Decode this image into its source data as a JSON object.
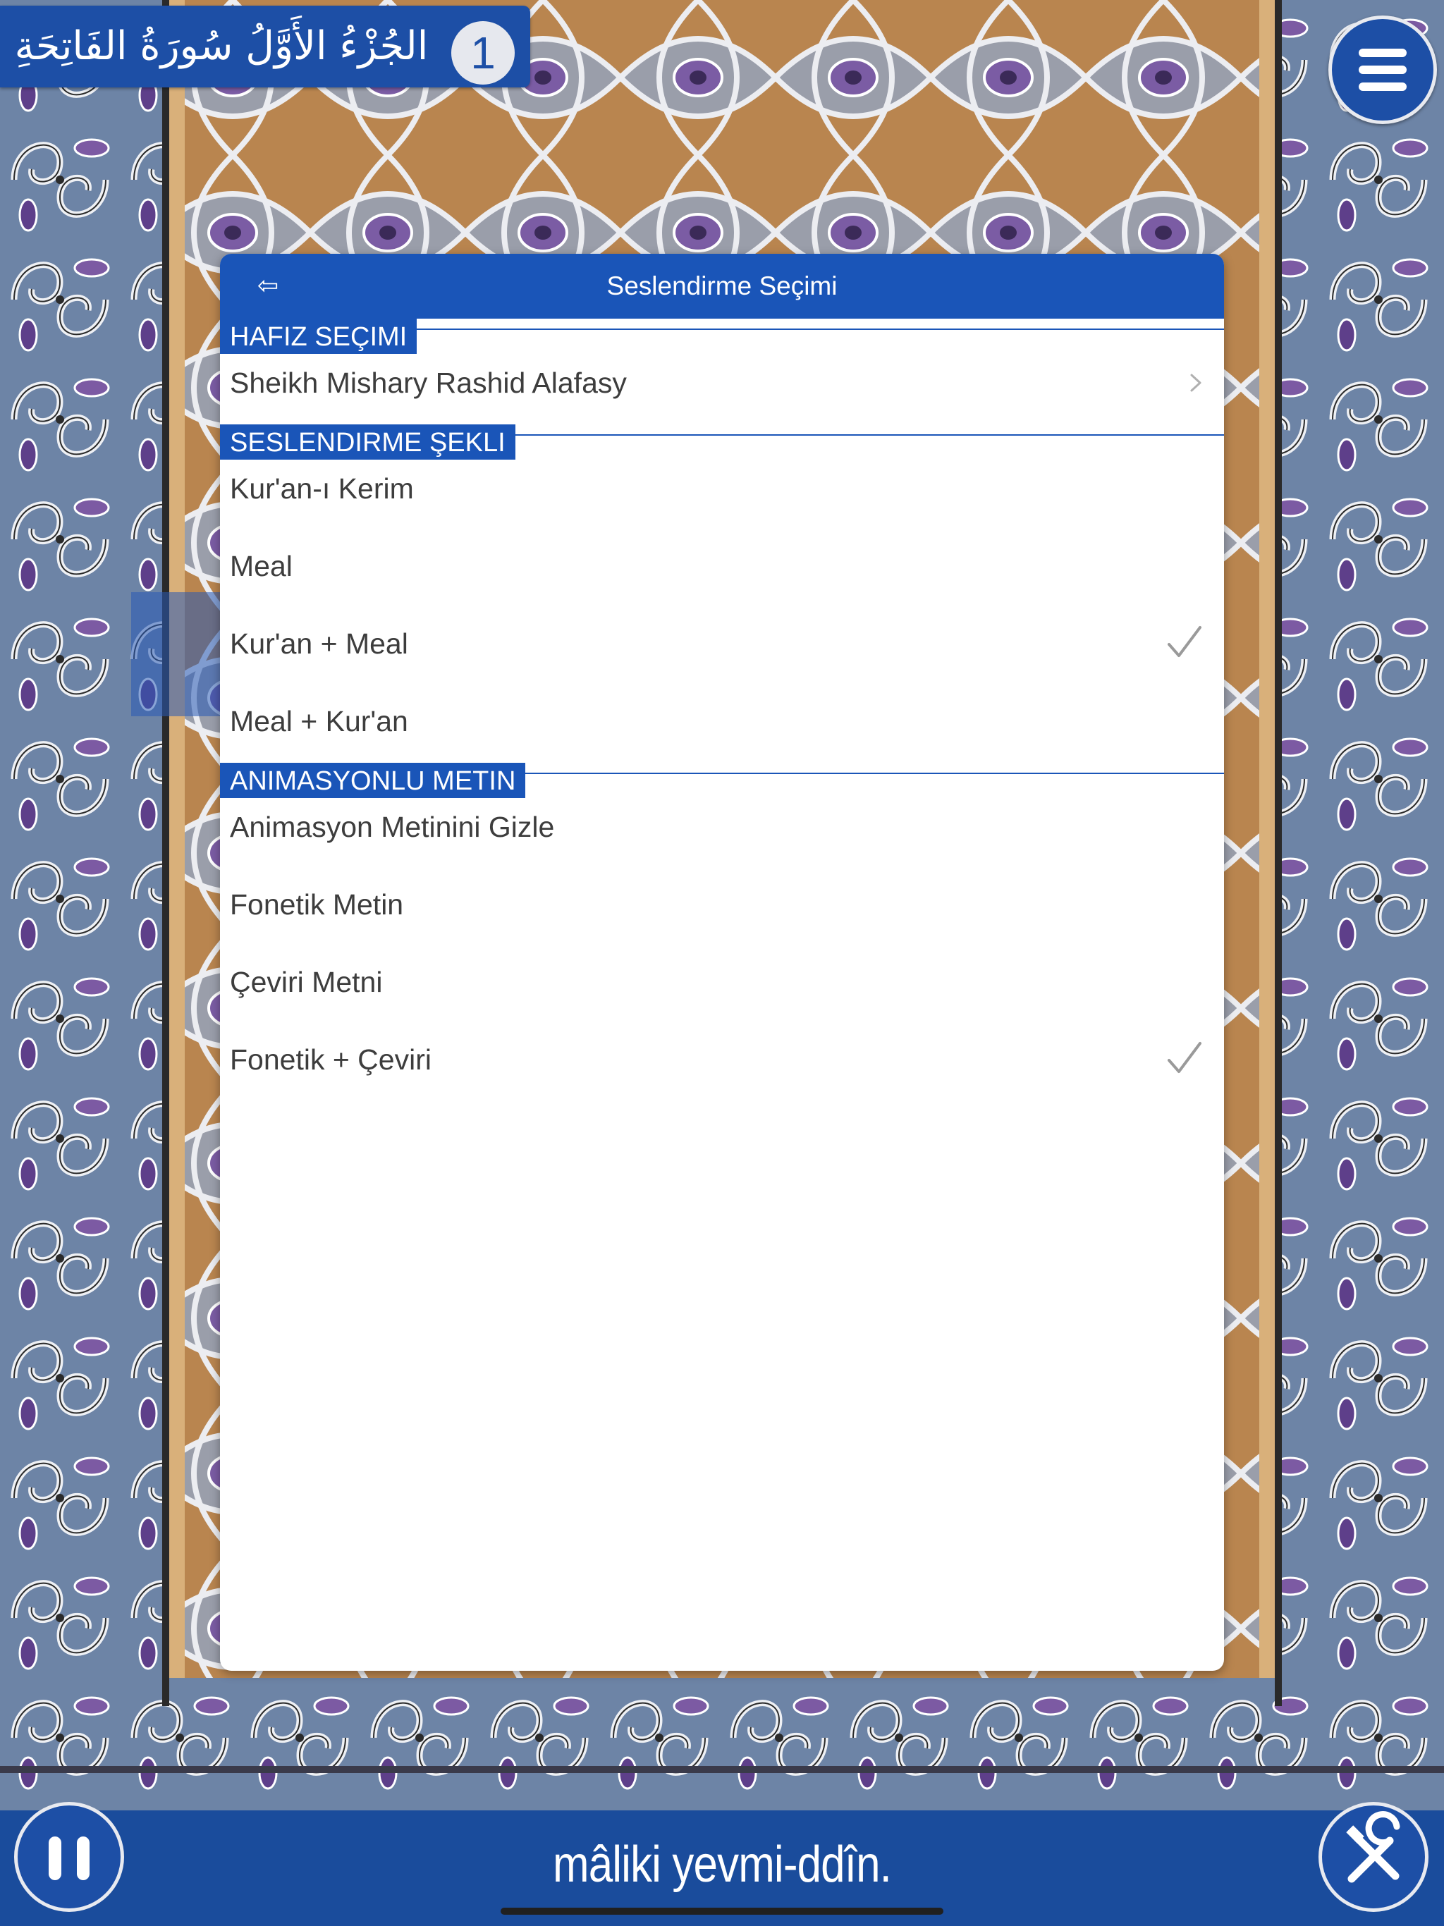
{
  "header": {
    "surah_title": "الجُزْءُ الأَوَّلُ سُورَةُ الفَاتِحَةِ",
    "juz_number": "1"
  },
  "icons": {
    "menu": "hamburger-menu-icon",
    "back": "back-arrow-icon",
    "checkmark": "checkmark-icon",
    "chevron": "chevron-right-icon",
    "pause": "pause-icon",
    "tools": "wrench-screwdriver-icon"
  },
  "colors": {
    "primary_blue": "#1a55b8",
    "bar_blue": "#1a4c9c",
    "text_gray": "#3d3d3d"
  },
  "modal": {
    "back_symbol": "⇦",
    "title": "Seslendirme Seçimi",
    "sections": [
      {
        "title": "HAFIZ SEÇIMI",
        "items": [
          {
            "label": "Sheikh Mishary Rashid Alafasy",
            "accessory": "chevron"
          }
        ]
      },
      {
        "title": "SESLENDIRME ŞEKLI",
        "items": [
          {
            "label": "Kur'an-ı Kerim",
            "checked": false
          },
          {
            "label": "Meal",
            "checked": false
          },
          {
            "label": "Kur'an + Meal",
            "checked": true
          },
          {
            "label": "Meal + Kur'an",
            "checked": false
          }
        ]
      },
      {
        "title": "ANIMASYONLU METIN",
        "items": [
          {
            "label": "Animasyon Metinini Gizle",
            "checked": false
          },
          {
            "label": "Fonetik Metin",
            "checked": false
          },
          {
            "label": "Çeviri Metni",
            "checked": false
          },
          {
            "label": "Fonetik + Çeviri",
            "checked": true
          }
        ]
      }
    ]
  },
  "player": {
    "caption": "mâliki yevmi-ddîn."
  }
}
